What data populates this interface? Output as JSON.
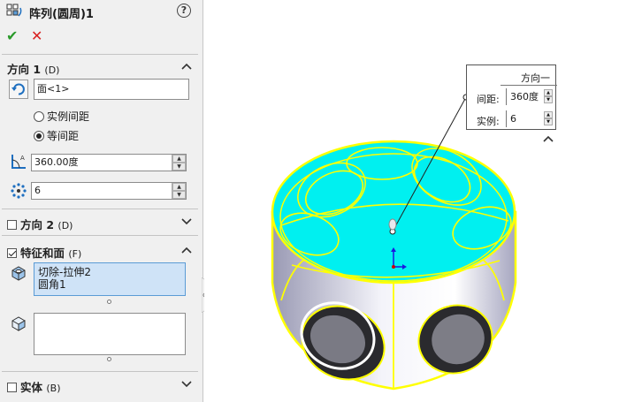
{
  "feature": {
    "title": "阵列(圆周)1",
    "help_label": "?"
  },
  "actions": {
    "ok": "✔",
    "cancel": "✕"
  },
  "direction1": {
    "header": "方向 1",
    "shortcut": "(D)",
    "axis_value": "面<1>",
    "radio_instance_spacing": "实例间距",
    "radio_equal_spacing": "等间距",
    "selected_radio": "等间距",
    "angle_value": "360.00度",
    "count_value": "6"
  },
  "direction2": {
    "header": "方向 2",
    "shortcut": "(D)",
    "checked": false
  },
  "features_faces": {
    "header": "特征和面",
    "shortcut": "(F)",
    "checked": true,
    "features": [
      "切除-拉伸2",
      "圆角1"
    ],
    "faces": []
  },
  "bodies": {
    "header": "实体",
    "shortcut": "(B)",
    "checked": false
  },
  "callout": {
    "title": "方向一",
    "spacing_label": "间距:",
    "spacing_value": "360度",
    "count_label": "实例:",
    "count_value": "6"
  },
  "colors": {
    "preview_cyan": "#00f0f0",
    "highlight_yellow": "#ffff00",
    "accent_blue": "#5b9bd5"
  }
}
